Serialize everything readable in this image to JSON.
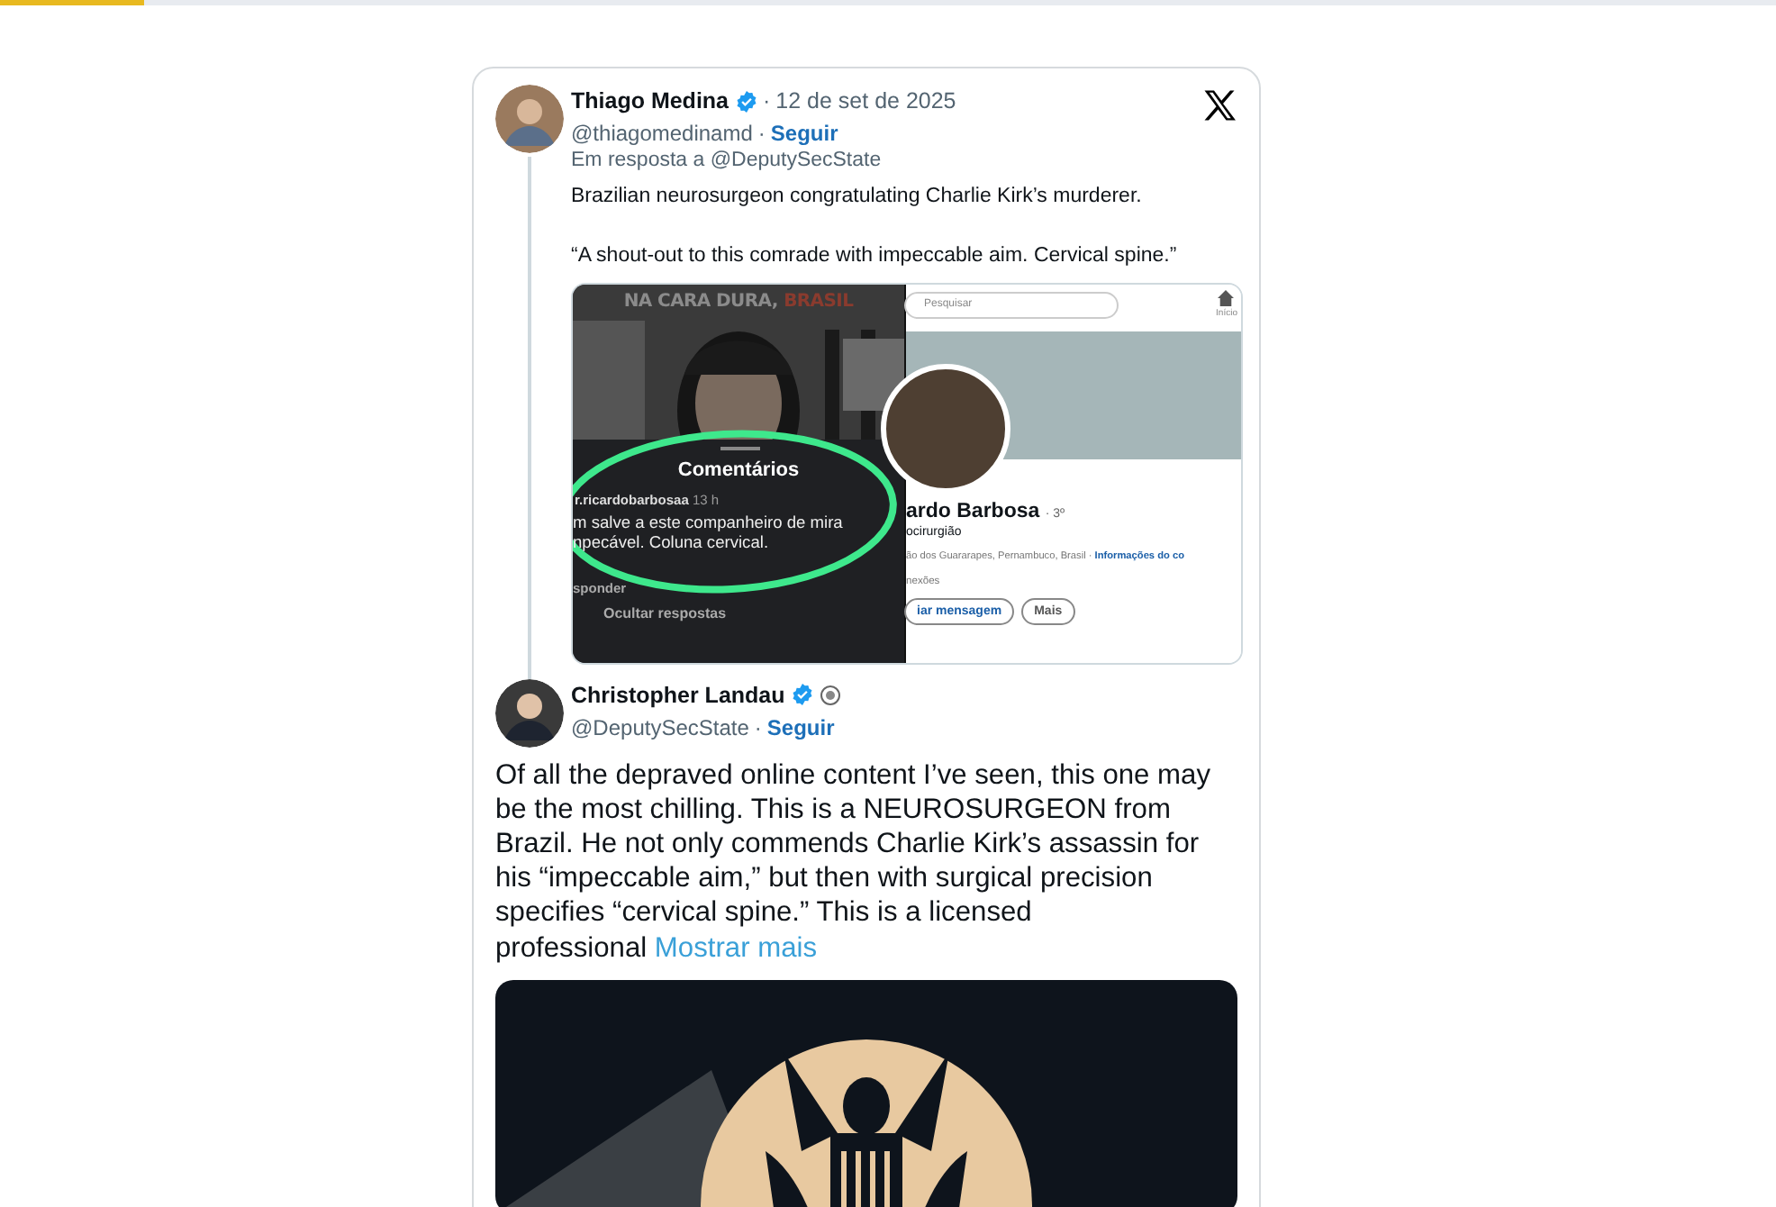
{
  "loading_bar": {
    "level": 0.081
  },
  "tweets": [
    {
      "author": "Thiago Medina",
      "verified": true,
      "affiliate_badge": false,
      "date_separator": "·",
      "date": "12 de set de 2025",
      "handle": "@thiagomedinamd",
      "handle_separator": "·",
      "follow": "Seguir",
      "reply_to": "Em resposta a @DeputySecState",
      "text": "Brazilian neurosurgeon congratulating Charlie Kirk’s murderer.\n\n“A shout-out to this comrade with impeccable aim. Cervical spine.”",
      "media": {
        "kind": "screenshots",
        "left": {
          "banner_part_1": "NA CARA DURA,",
          "banner_part_2": "BRASIL",
          "panel_title": "Comentários",
          "comment_user": "r.ricardobarbosaa",
          "comment_time": "13 h",
          "comment_lines": [
            "m salve a este companheiro de mira",
            "npecável. Coluna cervical."
          ],
          "reply": "sponder",
          "hide_replies": "Ocultar respostas"
        },
        "right": {
          "search_placeholder": "Pesquisar",
          "home_label": "Início",
          "name": "ardo Barbosa",
          "degree": "· 3º",
          "headline": "ocirurgião",
          "location": "ão dos Guararapes, Pernambuco, Brasil · ",
          "contact_link": "Informações do co",
          "connections": "nexões",
          "buttons": [
            "iar mensagem",
            "Mais"
          ]
        }
      }
    },
    {
      "author": "Christopher Landau",
      "verified": true,
      "affiliate_badge": true,
      "handle": "@DeputySecState",
      "handle_separator": "·",
      "follow": "Seguir",
      "text": "Of all the depraved online content I’ve seen, this one may\nbe the most chilling. This is a NEUROSURGEON from\nBrazil. He not only commends Charlie Kirk’s assassin for\nhis “impeccable aim,” but then with surgical precision\nspecifies “cervical spine.” This is a licensed\nprofessional",
      "more_link": "Mostrar mais"
    }
  ]
}
